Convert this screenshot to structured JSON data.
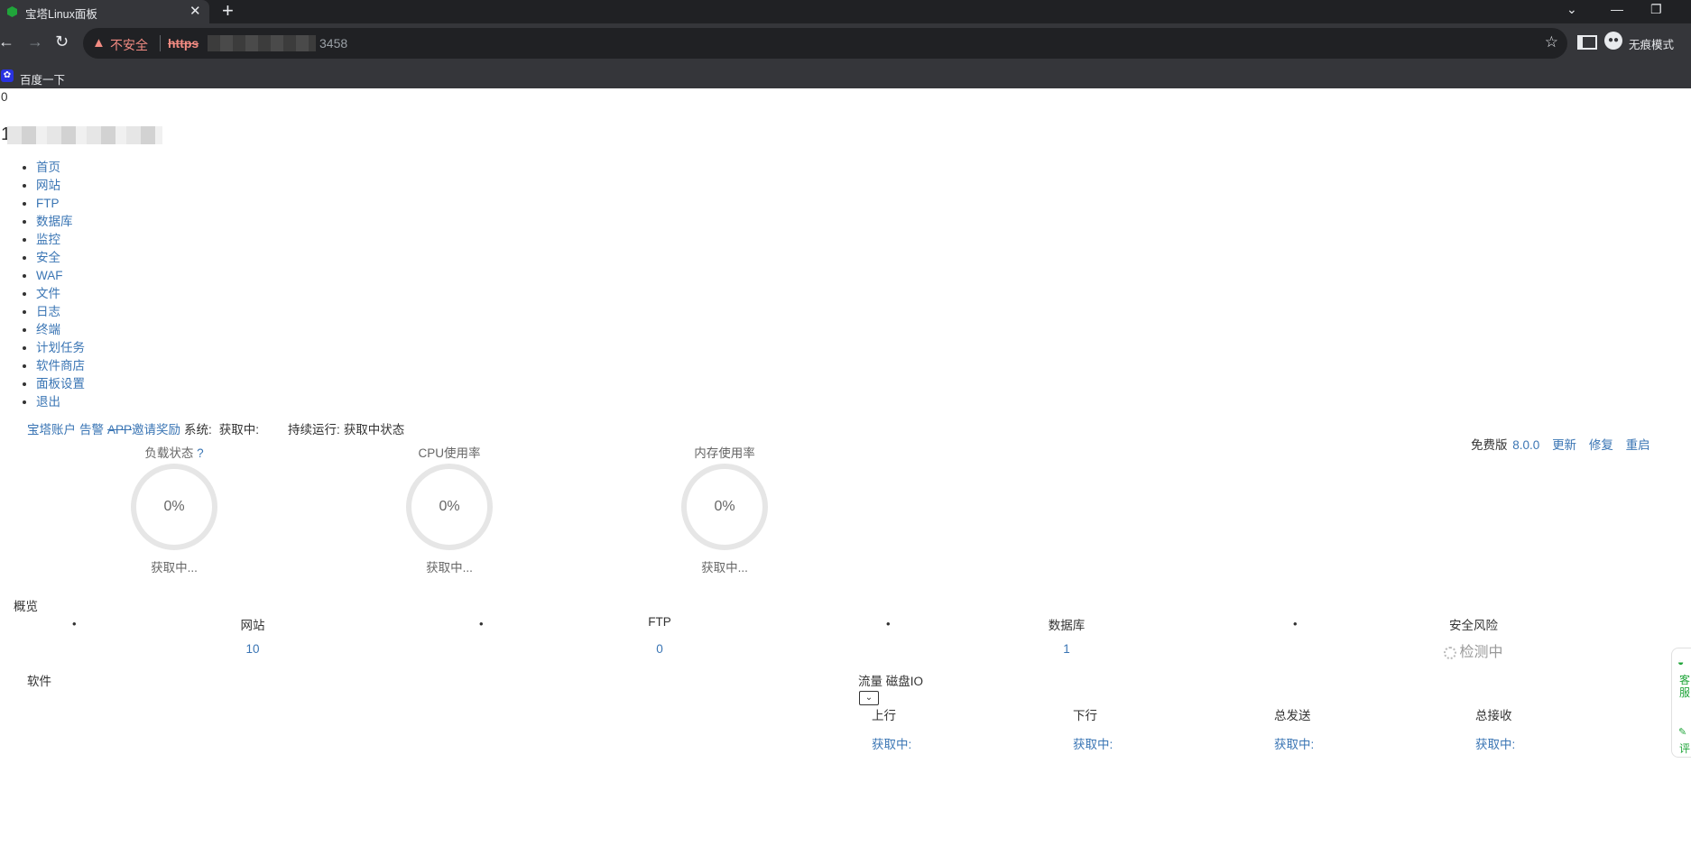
{
  "browser": {
    "tab_title": "宝塔Linux面板",
    "tab_close": "✕",
    "new_tab": "+",
    "not_secure": "不安全",
    "url_protocol": "https",
    "url_port": "3458",
    "incognito_label": "无痕模式",
    "bookmark_label": "百度一下"
  },
  "header": {
    "zero": "0",
    "host_prefix": "1"
  },
  "menu": {
    "items": [
      "首页",
      "网站",
      "FTP",
      "数据库",
      "监控",
      "安全",
      "WAF",
      "文件",
      "日志",
      "终端",
      "计划任务",
      "软件商店",
      "面板设置",
      "退出"
    ]
  },
  "topline": {
    "account": "宝塔账户",
    "alarm": "告警",
    "app": "APP",
    "invite": "邀请奖励",
    "system_label": "系统:",
    "system_value": "获取中:",
    "uptime_label": "持续运行:",
    "uptime_value": "获取中状态"
  },
  "edition": {
    "label": "免费版",
    "version": "8.0.0",
    "update": "更新",
    "repair": "修复",
    "restart": "重启"
  },
  "gauges": [
    {
      "title": "负载状态",
      "help": "?",
      "value": "0%",
      "status": "获取中..."
    },
    {
      "title": "CPU使用率",
      "value": "0%",
      "status": "获取中..."
    },
    {
      "title": "内存使用率",
      "value": "0%",
      "status": "获取中..."
    }
  ],
  "overview": {
    "title": "概览",
    "stats": [
      {
        "label": "网站",
        "value": "10"
      },
      {
        "label": "FTP",
        "value": "0"
      },
      {
        "label": "数据库",
        "value": "1"
      },
      {
        "label": "安全风险",
        "value": "检测中"
      }
    ]
  },
  "software": {
    "title": "软件"
  },
  "traffic": {
    "tab_flow": "流量",
    "tab_disk": "磁盘IO",
    "columns": [
      {
        "label": "上行",
        "value": "获取中:"
      },
      {
        "label": "下行",
        "value": "获取中:"
      },
      {
        "label": "总发送",
        "value": "获取中:"
      },
      {
        "label": "总接收",
        "value": "获取中:"
      }
    ]
  },
  "widget": {
    "text1": "客服",
    "text2": "评"
  }
}
